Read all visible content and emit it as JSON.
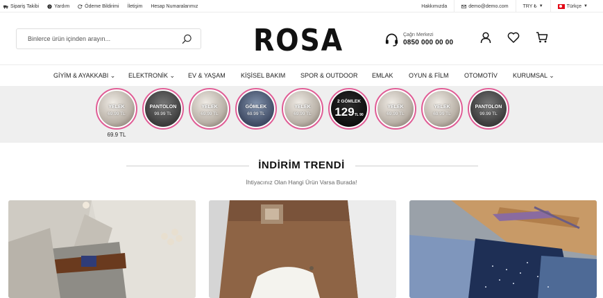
{
  "topbar": {
    "order_tracking": "Sipariş Takibi",
    "help": "Yardım",
    "payment_notice": "Ödeme Bildirimi",
    "contact": "İletişim",
    "bank_accounts": "Hesap Numaralarımız",
    "about": "Hakkımızda",
    "email": "demo@demo.com",
    "currency": "TRY ₺",
    "language": "Türkçe"
  },
  "header": {
    "search_placeholder": "Binlerce ürün içinden arayın...",
    "logo_text": "ROSA",
    "support_label": "Çağrı Merkezi",
    "support_phone": "0850 000 00 00"
  },
  "nav": [
    {
      "label": "GİYİM & AYAKKABI",
      "has_dropdown": true
    },
    {
      "label": "ELEKTRONİK",
      "has_dropdown": true
    },
    {
      "label": "EV & YAŞAM",
      "has_dropdown": false
    },
    {
      "label": "KİŞİSEL BAKIM",
      "has_dropdown": false
    },
    {
      "label": "SPOR & OUTDOOR",
      "has_dropdown": false
    },
    {
      "label": "EMLAK",
      "has_dropdown": false
    },
    {
      "label": "OYUN & FİLM",
      "has_dropdown": false
    },
    {
      "label": "OTOMOTİV",
      "has_dropdown": false
    },
    {
      "label": "KURUMSAL",
      "has_dropdown": true
    }
  ],
  "dropdown_caret": "⌄",
  "stories": [
    {
      "tag": "YELEK",
      "price": "69.99 TL",
      "theme": "light",
      "label": "69.9 TL"
    },
    {
      "tag": "PANTOLON",
      "price": "99.99 TL",
      "theme": "dark",
      "label": ""
    },
    {
      "tag": "YELEK",
      "price": "69.99 TL",
      "theme": "light",
      "label": ""
    },
    {
      "tag": "GÖMLEK",
      "price": "69.99 TL",
      "theme": "blue",
      "label": ""
    },
    {
      "tag": "YELEK",
      "price": "69.99 TL",
      "theme": "light",
      "label": ""
    },
    {
      "tag": "2 GÖMLEK",
      "price": "129",
      "price_small": "TL 90",
      "theme": "black",
      "label": ""
    },
    {
      "tag": "YELEK",
      "price": "69.99 TL",
      "theme": "light",
      "label": ""
    },
    {
      "tag": "YELEK",
      "price": "69.99 TL",
      "theme": "light",
      "label": ""
    },
    {
      "tag": "PANTOLON",
      "price": "99.99 TL",
      "theme": "dark",
      "label": ""
    }
  ],
  "section": {
    "title": "İNDİRİM TRENDİ",
    "subtitle": "İhtiyacınız Olan Hangi Ürün Varsa Burada!"
  },
  "colors": {
    "story_ring": "#e05c95",
    "strip_bg": "#efefef",
    "flag_red": "#e30a17"
  }
}
